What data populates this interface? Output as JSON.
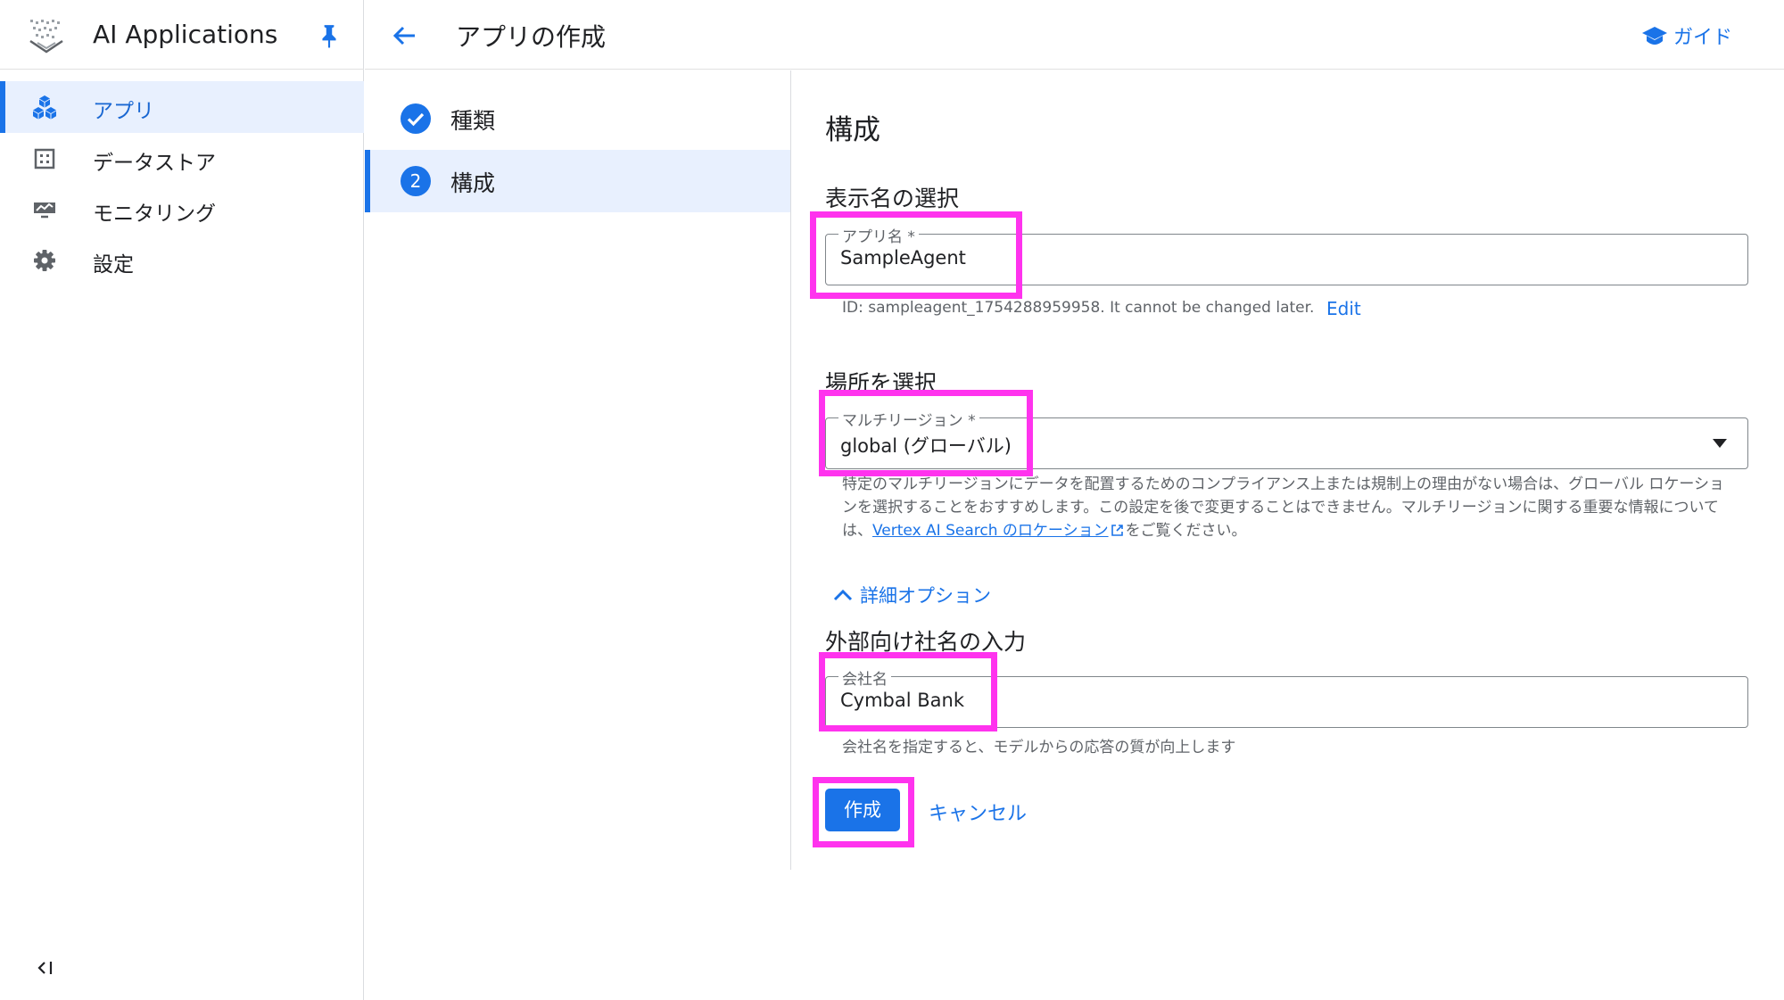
{
  "app": {
    "title": "AI Applications"
  },
  "sidebar": {
    "items": [
      {
        "label": "アプリ",
        "icon": "apps-cubes-icon",
        "active": true
      },
      {
        "label": "データストア",
        "icon": "data-store-icon",
        "active": false
      },
      {
        "label": "モニタリング",
        "icon": "monitoring-icon",
        "active": false
      },
      {
        "label": "設定",
        "icon": "gear-icon",
        "active": false
      }
    ]
  },
  "header": {
    "title": "アプリの作成",
    "guide_label": "ガイド"
  },
  "steps": [
    {
      "label": "種類",
      "status": "done"
    },
    {
      "number": "2",
      "label": "構成",
      "status": "active"
    }
  ],
  "form": {
    "title": "構成",
    "display_name": {
      "heading": "表示名の選択",
      "field_label": "アプリ名 *",
      "value": "SampleAgent",
      "id_prefix": "ID: ",
      "id_value": "sampleagent_1754288959958",
      "id_suffix": ". It cannot be changed later.",
      "edit_label": "Edit"
    },
    "location": {
      "heading": "場所を選択",
      "field_label": "マルチリージョン *",
      "value": "global (グローバル)",
      "help_part1": "特定のマルチリージョンにデータを配置するためのコンプライアンス上または規制上の理由がない場合は、グローバル ロケーションを選択することをおすすめします。この設定を後で変更することはできません。マルチリージョンに関する重要な情報については、",
      "help_link": "Vertex AI Search のロケーション",
      "help_part2": "をご覧ください。"
    },
    "advanced_label": "詳細オプション",
    "company": {
      "heading": "外部向け社名の入力",
      "field_label": "会社名",
      "value": "Cymbal Bank",
      "helper": "会社名を指定すると、モデルからの応答の質が向上します"
    },
    "create_label": "作成",
    "cancel_label": "キャンセル"
  },
  "colors": {
    "accent": "#1a73e8",
    "highlight": "#ff33ee",
    "active_bg": "#e8f0fe"
  }
}
